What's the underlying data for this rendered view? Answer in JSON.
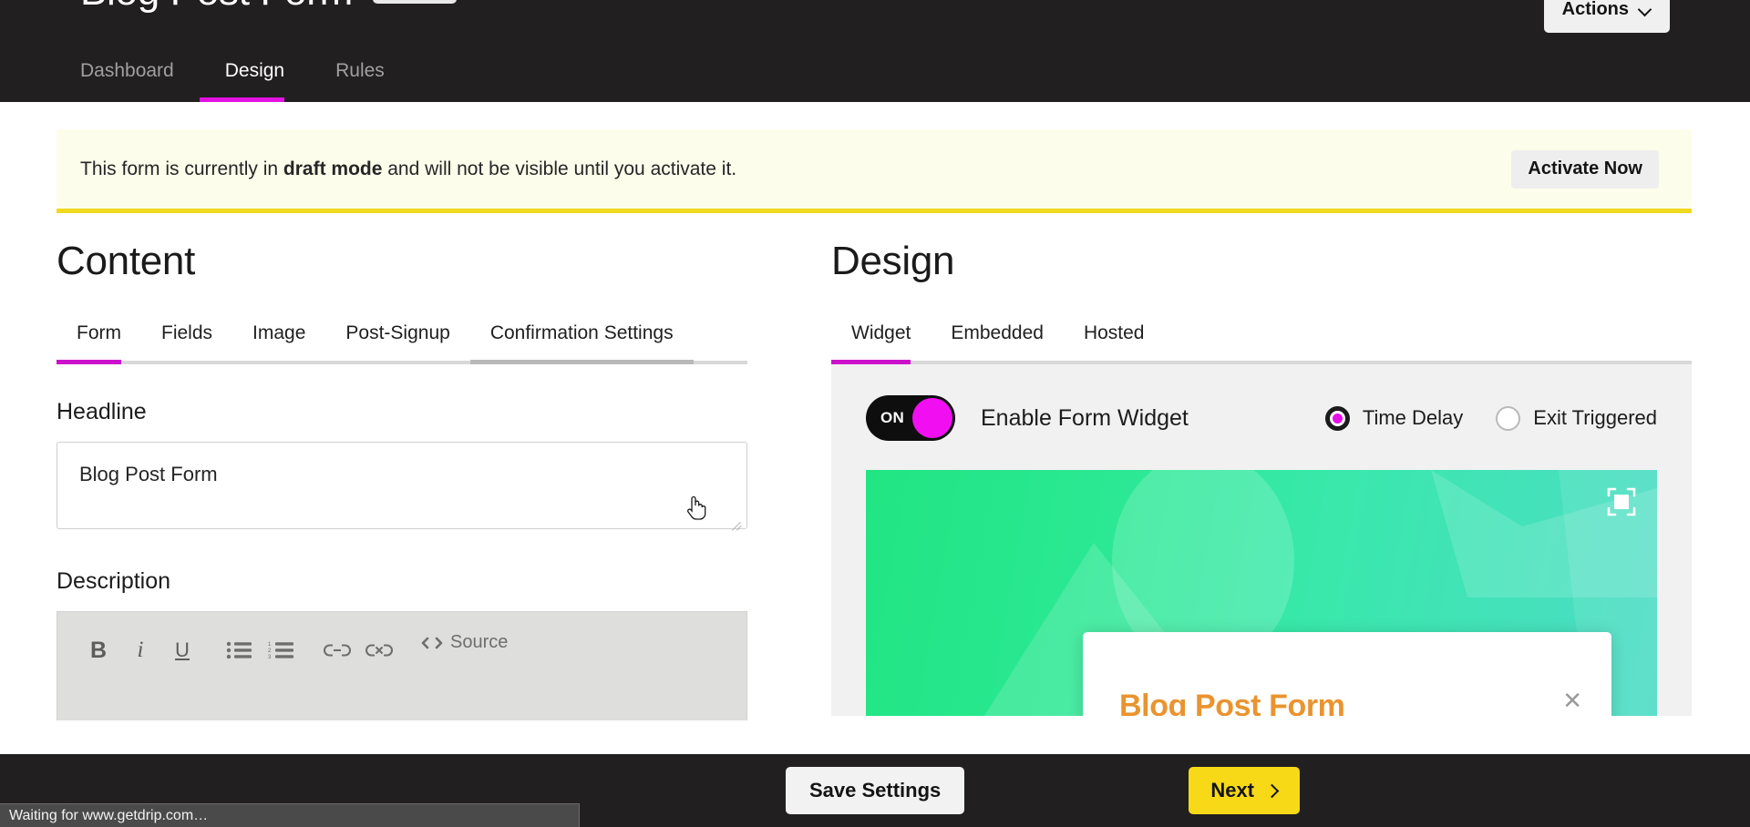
{
  "header": {
    "page_title": "Blog Post Form",
    "actions_label": "Actions",
    "chevron_icon": "chevron-down-icon",
    "nav_tabs": [
      {
        "label": "Dashboard",
        "active": false
      },
      {
        "label": "Design",
        "active": true
      },
      {
        "label": "Rules",
        "active": false
      }
    ]
  },
  "banner": {
    "text_before": "This form is currently in ",
    "text_bold": "draft mode",
    "text_after": " and will not be visible until you activate it.",
    "button_label": "Activate Now",
    "accent_color": "#f0d91e",
    "background_color": "#fdfdeb"
  },
  "content": {
    "title": "Content",
    "tabs": [
      {
        "label": "Form",
        "state": "active"
      },
      {
        "label": "Fields",
        "state": ""
      },
      {
        "label": "Image",
        "state": ""
      },
      {
        "label": "Post-Signup",
        "state": ""
      },
      {
        "label": "Confirmation Settings",
        "state": "hovered"
      }
    ],
    "headline_label": "Headline",
    "headline_value": "Blog Post Form",
    "description_label": "Description",
    "toolbar": [
      {
        "name": "bold-icon",
        "glyph": "B"
      },
      {
        "name": "italic-icon",
        "glyph": "i"
      },
      {
        "name": "underline-icon",
        "glyph": "U"
      },
      {
        "name": "bullet-list-icon",
        "glyph": ""
      },
      {
        "name": "numbered-list-icon",
        "glyph": ""
      },
      {
        "name": "link-icon",
        "glyph": ""
      },
      {
        "name": "unlink-icon",
        "glyph": ""
      }
    ],
    "source_label": "Source",
    "source_icon": "code-brackets-icon"
  },
  "design": {
    "title": "Design",
    "tabs": [
      {
        "label": "Widget",
        "state": "active"
      },
      {
        "label": "Embedded",
        "state": ""
      },
      {
        "label": "Hosted",
        "state": ""
      }
    ],
    "toggle_state_label": "ON",
    "toggle_text": "Enable Form Widget",
    "toggle_accent": "#f10ff1",
    "trigger_options": [
      {
        "label": "Time Delay",
        "selected": true
      },
      {
        "label": "Exit Triggered",
        "selected": false
      }
    ],
    "preview": {
      "expand_icon": "fullscreen-expand-icon",
      "modal_title": "Blog Post Form",
      "modal_title_color": "#e9942f",
      "close_icon": "close-x-icon",
      "close_glyph": "✕"
    }
  },
  "footer": {
    "save_label": "Save Settings",
    "next_label": "Next",
    "next_icon": "chevron-right-icon",
    "next_color": "#f7d917"
  },
  "statusbar": {
    "text": "Waiting for www.getdrip.com…"
  }
}
